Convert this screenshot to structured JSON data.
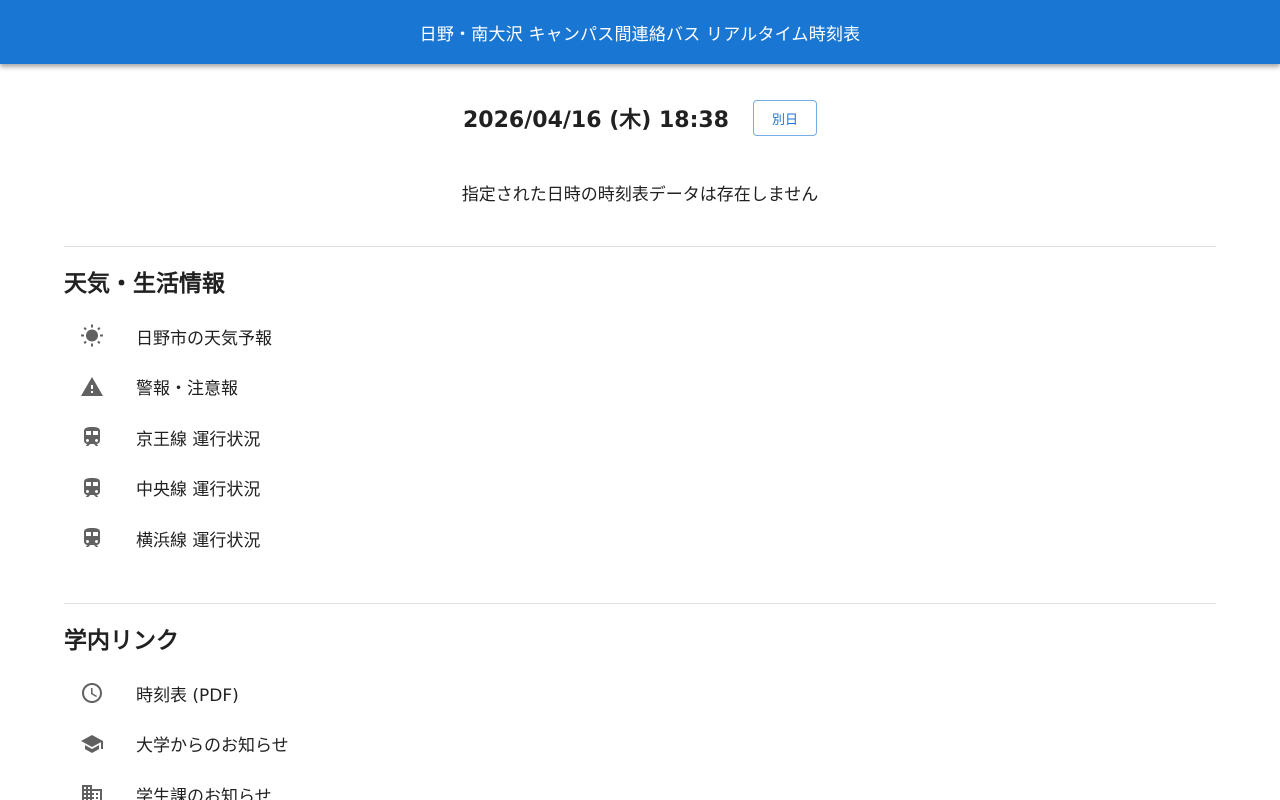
{
  "header": {
    "title": "日野・南大沢 キャンパス間連絡バス リアルタイム時刻表",
    "background_color": "#1976d2"
  },
  "datetime": {
    "display": "2026/04/16 (木) 18:38",
    "other_day_label": "別日"
  },
  "timetable": {
    "no_data_message": "指定された日時の時刻表データは存在しません"
  },
  "weather_section": {
    "title": "天気・生活情報",
    "items": [
      {
        "label": "日野市の天気予報",
        "icon": "sun-icon"
      },
      {
        "label": "警報・注意報",
        "icon": "warning-icon"
      },
      {
        "label": "京王線 運行状況",
        "icon": "train-icon"
      },
      {
        "label": "中央線 運行状況",
        "icon": "train-icon"
      },
      {
        "label": "横浜線 運行状況",
        "icon": "train-icon"
      }
    ]
  },
  "campus_links_section": {
    "title": "学内リンク",
    "items": [
      {
        "label": "時刻表 (PDF)",
        "icon": "clock-icon"
      },
      {
        "label": "大学からのお知らせ",
        "icon": "graduation-cap-icon"
      },
      {
        "label": "学生課のお知らせ",
        "icon": "building-icon"
      }
    ]
  },
  "colors": {
    "accent": "#1976d2",
    "icon": "#616161",
    "divider": "#e0e0e0"
  }
}
